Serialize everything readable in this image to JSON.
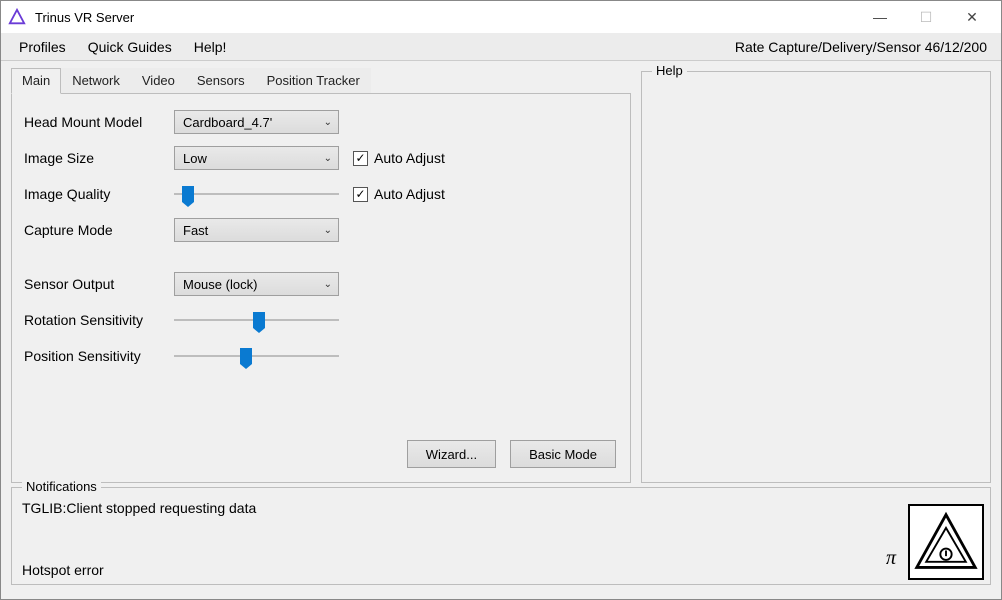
{
  "window": {
    "title": "Trinus VR Server"
  },
  "menubar": {
    "items": [
      "Profiles",
      "Quick Guides",
      "Help!"
    ],
    "status": "Rate Capture/Delivery/Sensor 46/12/200"
  },
  "tabs": [
    "Main",
    "Network",
    "Video",
    "Sensors",
    "Position Tracker"
  ],
  "active_tab": 0,
  "main_tab": {
    "head_mount_model": {
      "label": "Head Mount Model",
      "value": "Cardboard_4.7'"
    },
    "image_size": {
      "label": "Image Size",
      "value": "Low",
      "auto_adjust_label": "Auto Adjust",
      "auto_adjust_checked": true
    },
    "image_quality": {
      "label": "Image Quality",
      "slider_percent": 5,
      "auto_adjust_label": "Auto Adjust",
      "auto_adjust_checked": true
    },
    "capture_mode": {
      "label": "Capture Mode",
      "value": "Fast"
    },
    "sensor_output": {
      "label": "Sensor Output",
      "value": "Mouse (lock)"
    },
    "rotation_sensitivity": {
      "label": "Rotation Sensitivity",
      "slider_percent": 48
    },
    "position_sensitivity": {
      "label": "Position Sensitivity",
      "slider_percent": 40
    },
    "buttons": {
      "wizard": "Wizard...",
      "basic_mode": "Basic Mode"
    }
  },
  "help_box": {
    "legend": "Help"
  },
  "notifications": {
    "legend": "Notifications",
    "line1": "TGLIB:Client stopped requesting data",
    "line2": "Hotspot error",
    "pi": "π"
  },
  "icons": {
    "app": "triangle-logo",
    "minimize": "—",
    "maximize": "☐",
    "close": "✕",
    "check": "✓",
    "chevron": "⌄"
  }
}
